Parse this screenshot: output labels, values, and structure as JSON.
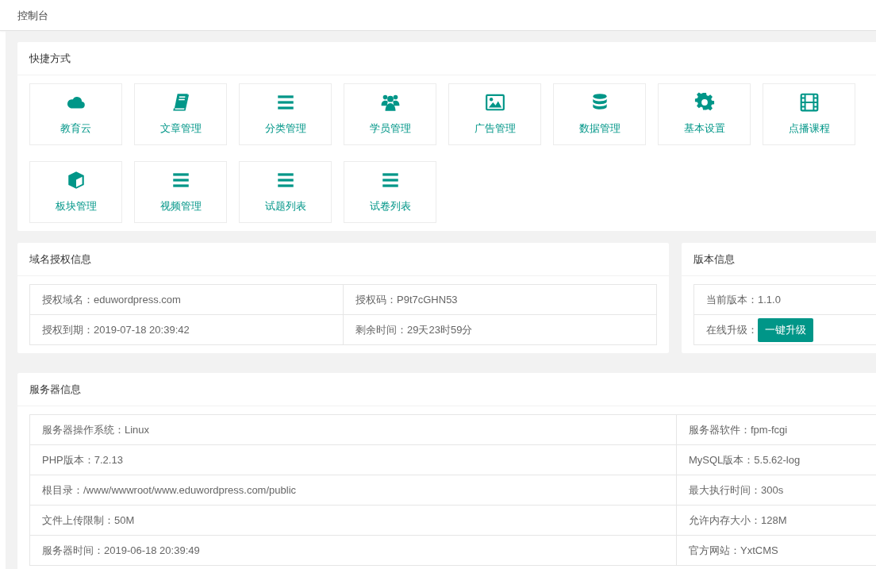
{
  "breadcrumb": "控制台",
  "shortcuts": {
    "title": "快捷方式",
    "items": [
      {
        "label": "教育云"
      },
      {
        "label": "文章管理"
      },
      {
        "label": "分类管理"
      },
      {
        "label": "学员管理"
      },
      {
        "label": "广告管理"
      },
      {
        "label": "数据管理"
      },
      {
        "label": "基本设置"
      },
      {
        "label": "点播课程"
      },
      {
        "label": "板块管理"
      },
      {
        "label": "视频管理"
      },
      {
        "label": "试题列表"
      },
      {
        "label": "试卷列表"
      }
    ]
  },
  "domain_license": {
    "title": "域名授权信息",
    "rows": [
      [
        "授权域名：eduwordpress.com",
        "授权码：P9t7cGHN53"
      ],
      [
        "授权到期：2019-07-18 20:39:42",
        "剩余时间：29天23时59分"
      ]
    ]
  },
  "version": {
    "title": "版本信息",
    "current": "当前版本：1.1.0",
    "upgrade_label": "在线升级：",
    "upgrade_button": "一键升级"
  },
  "server": {
    "title": "服务器信息",
    "rows": [
      [
        "服务器操作系统：Linux",
        "服务器软件：fpm-fcgi"
      ],
      [
        "PHP版本：7.2.13",
        "MySQL版本：5.5.62-log"
      ],
      [
        "根目录：/www/wwwroot/www.eduwordpress.com/public",
        "最大执行时间：300s"
      ],
      [
        "文件上传限制：50M",
        "允许内存大小：128M"
      ],
      [
        "服务器时间：2019-06-18 20:39:49",
        "官方网站：YxtCMS"
      ]
    ]
  }
}
